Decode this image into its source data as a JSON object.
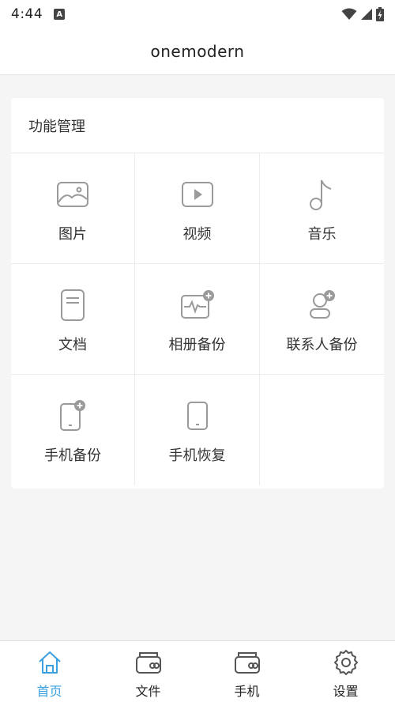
{
  "status_bar": {
    "time": "4:44",
    "notification_icon": "android-a-icon",
    "wifi_icon": "wifi-icon",
    "signal_icon": "signal-icon",
    "battery_icon": "battery-charging-icon"
  },
  "header": {
    "title": "onemodern"
  },
  "card": {
    "title": "功能管理",
    "items": [
      {
        "label": "图片",
        "icon": "image-icon"
      },
      {
        "label": "视频",
        "icon": "video-icon"
      },
      {
        "label": "音乐",
        "icon": "music-note-icon"
      },
      {
        "label": "文档",
        "icon": "document-icon"
      },
      {
        "label": "相册备份",
        "icon": "album-backup-icon"
      },
      {
        "label": "联系人备份",
        "icon": "contact-backup-icon"
      },
      {
        "label": "手机备份",
        "icon": "phone-backup-icon"
      },
      {
        "label": "手机恢复",
        "icon": "phone-restore-icon"
      }
    ]
  },
  "bottom_nav": {
    "items": [
      {
        "label": "首页",
        "icon": "home-icon",
        "active": true
      },
      {
        "label": "文件",
        "icon": "files-icon",
        "active": false
      },
      {
        "label": "手机",
        "icon": "phone-icon",
        "active": false
      },
      {
        "label": "设置",
        "icon": "gear-icon",
        "active": false
      }
    ]
  },
  "colors": {
    "accent": "#3aa0e0",
    "icon_gray": "#9a9a9a",
    "background": "#f5f5f5"
  }
}
